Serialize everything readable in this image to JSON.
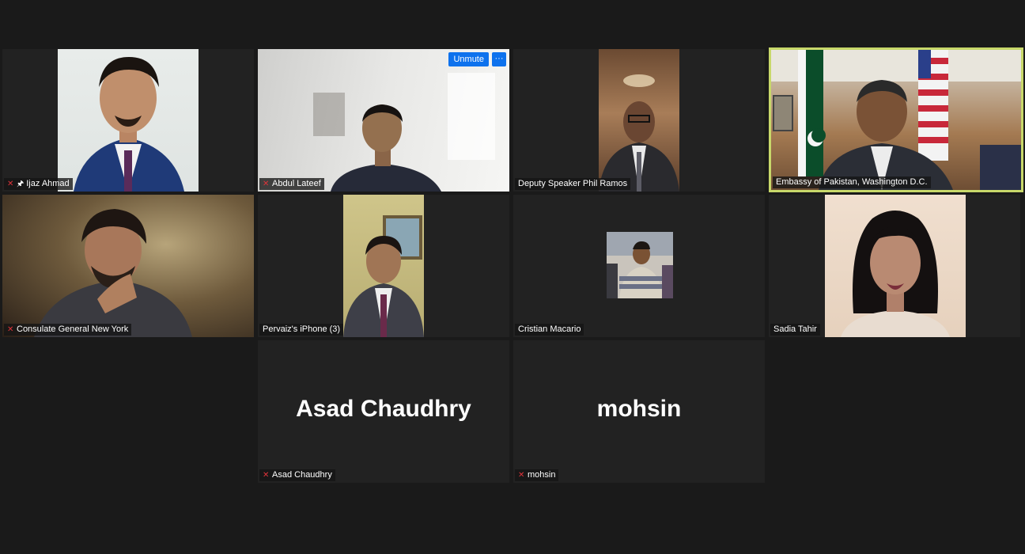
{
  "participants": [
    {
      "name": "Ijaz Ahmad",
      "muted": true,
      "pinned": true
    },
    {
      "name": "Abdul Lateef",
      "muted": true
    },
    {
      "name": "Deputy Speaker Phil Ramos",
      "muted": false
    },
    {
      "name": "Embassy of Pakistan, Washington D.C.",
      "muted": false,
      "active_speaker": true
    },
    {
      "name": "Consulate General New York",
      "muted": true
    },
    {
      "name": "Pervaiz's iPhone (3)",
      "muted": false
    },
    {
      "name": "Cristian Macario",
      "muted": false
    },
    {
      "name": "Sadia Tahir",
      "muted": false
    },
    {
      "name": "Asad Chaudhry",
      "muted": true,
      "video_off_label": "Asad Chaudhry"
    },
    {
      "name": "mohsin",
      "muted": true,
      "video_off_label": "mohsin"
    }
  ],
  "controls": {
    "unmute_label": "Unmute",
    "more_label": "···"
  },
  "colors": {
    "background": "#1a1a1a",
    "tile": "#222222",
    "active_border": "#c8d86a",
    "button_blue": "#0e72ed",
    "mic_muted": "#e0333a"
  }
}
